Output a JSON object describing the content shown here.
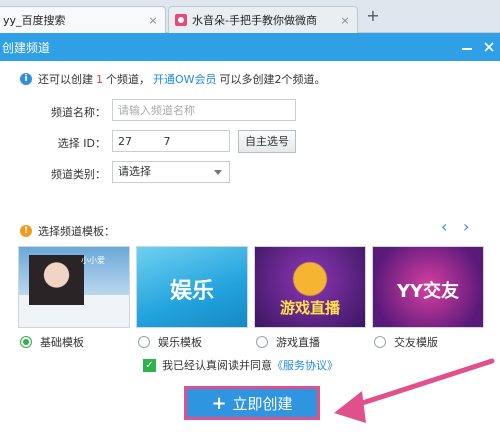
{
  "browser": {
    "tabs": [
      {
        "title": "yy_百度搜索",
        "close": "×"
      },
      {
        "title": "水音朵-手把手教你做微商",
        "close": "×"
      }
    ],
    "new_tab": "+"
  },
  "dialog": {
    "title": "创建频道",
    "info": {
      "prefix": "还可以创建",
      "count": "1",
      "mid": "个频道，",
      "link": "开通OW会员",
      "suffix": "可以多创建2个频道。"
    },
    "form": {
      "name_label": "频道名称：",
      "name_placeholder": "请输入频道名称",
      "id_label": "选择 ID：",
      "id_value": "27         7",
      "self_select": "自主选号",
      "category_label": "频道类别：",
      "category_value": "请选择"
    },
    "templates": {
      "header": "选择频道模板：",
      "prev": "‹",
      "next": "›",
      "items": [
        {
          "label": "基础模板",
          "selected": true,
          "thumb_text": "小小爱"
        },
        {
          "label": "娱乐模板",
          "selected": false,
          "thumb_text": "娱乐"
        },
        {
          "label": "游戏直播",
          "selected": false,
          "thumb_text": "游戏直播"
        },
        {
          "label": "交友模版",
          "selected": false,
          "thumb_text": "YY交友"
        }
      ]
    },
    "agree": {
      "text": "我已经认真阅读并同意",
      "link": "《服务协议》"
    },
    "create_button": "立即创建"
  },
  "colors": {
    "titlebar": "#2f9fe6",
    "accent": "#2f95e0",
    "annotation": "#e0508a",
    "selected": "#2eb34a"
  }
}
